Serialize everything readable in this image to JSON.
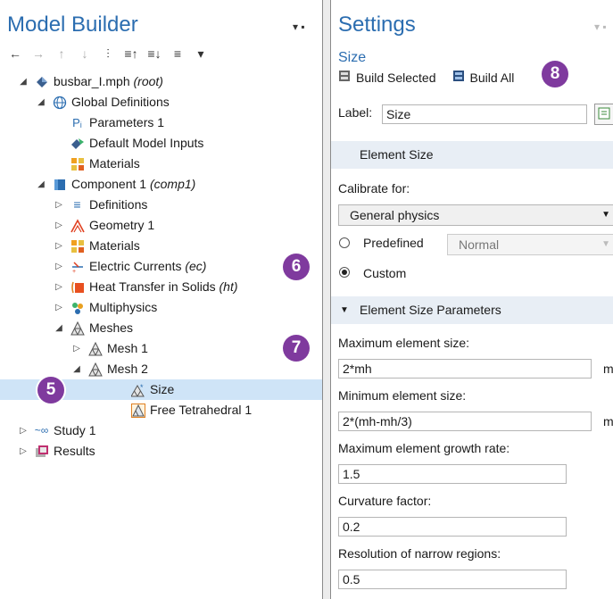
{
  "left": {
    "title": "Model Builder",
    "controls": "▾ ▪",
    "toolbar": [
      "←",
      "→",
      "↑",
      "↓",
      "⫶",
      "≡↑",
      "≡↓",
      "≡",
      "▾"
    ]
  },
  "tree": [
    {
      "label": "busbar_I.mph",
      "tag": "(root)",
      "icon": "model-icon"
    },
    {
      "label": "Global Definitions",
      "tag": "",
      "icon": "globe-icon"
    },
    {
      "label": "Parameters 1",
      "tag": "",
      "icon": "parameters-icon",
      "glyph": "Pᵢ"
    },
    {
      "label": "Default Model Inputs",
      "tag": "",
      "icon": "model-inputs-icon"
    },
    {
      "label": "Materials",
      "tag": "",
      "icon": "materials-icon"
    },
    {
      "label": "Component 1",
      "tag": "(comp1)",
      "icon": "component-icon"
    },
    {
      "label": "Definitions",
      "tag": "",
      "icon": "definitions-icon"
    },
    {
      "label": "Geometry 1",
      "tag": "",
      "icon": "geometry-icon"
    },
    {
      "label": "Materials",
      "tag": "",
      "icon": "materials-icon"
    },
    {
      "label": "Electric Currents",
      "tag": "(ec)",
      "icon": "electric-currents-icon"
    },
    {
      "label": "Heat Transfer in Solids",
      "tag": "(ht)",
      "icon": "heat-transfer-icon"
    },
    {
      "label": "Multiphysics",
      "tag": "",
      "icon": "multiphysics-icon"
    },
    {
      "label": "Meshes",
      "tag": "",
      "icon": "mesh-icon"
    },
    {
      "label": "Mesh 1",
      "tag": "",
      "icon": "mesh-icon"
    },
    {
      "label": "Mesh 2",
      "tag": "",
      "icon": "mesh-icon"
    },
    {
      "label": "Size",
      "tag": "",
      "icon": "size-icon"
    },
    {
      "label": "Free Tetrahedral 1",
      "tag": "",
      "icon": "free-tetrahedral-icon"
    },
    {
      "label": "Study 1",
      "tag": "",
      "icon": "study-icon"
    },
    {
      "label": "Results",
      "tag": "",
      "icon": "results-icon"
    }
  ],
  "badges": [
    "5",
    "6",
    "7",
    "8"
  ],
  "right": {
    "title": "Settings",
    "controls": "▾ ▪",
    "subtitle": "Size",
    "build_selected": "Build Selected",
    "build_all": "Build All",
    "label_caption": "Label:",
    "label_value": "Size",
    "section1": "Element Size",
    "calibrate_caption": "Calibrate for:",
    "calibrate_value": "General physics",
    "predefined_label": "Predefined",
    "predefined_value": "Normal",
    "custom_label": "Custom",
    "section2": "Element Size Parameters",
    "max_size_caption": "Maximum element size:",
    "max_size_value": "2*mh",
    "max_size_unit": "m",
    "min_size_caption": "Minimum element size:",
    "min_size_value": "2*(mh-mh/3)",
    "min_size_unit": "m",
    "growth_caption": "Maximum element growth rate:",
    "growth_value": "1.5",
    "curvature_caption": "Curvature factor:",
    "curvature_value": "0.2",
    "narrow_caption": "Resolution of narrow regions:",
    "narrow_value": "0.5"
  },
  "colors": {
    "accent": "#2b6db0",
    "badge": "#7f3a9e",
    "selected": "#cfe4f7",
    "section": "#e8eef5"
  }
}
